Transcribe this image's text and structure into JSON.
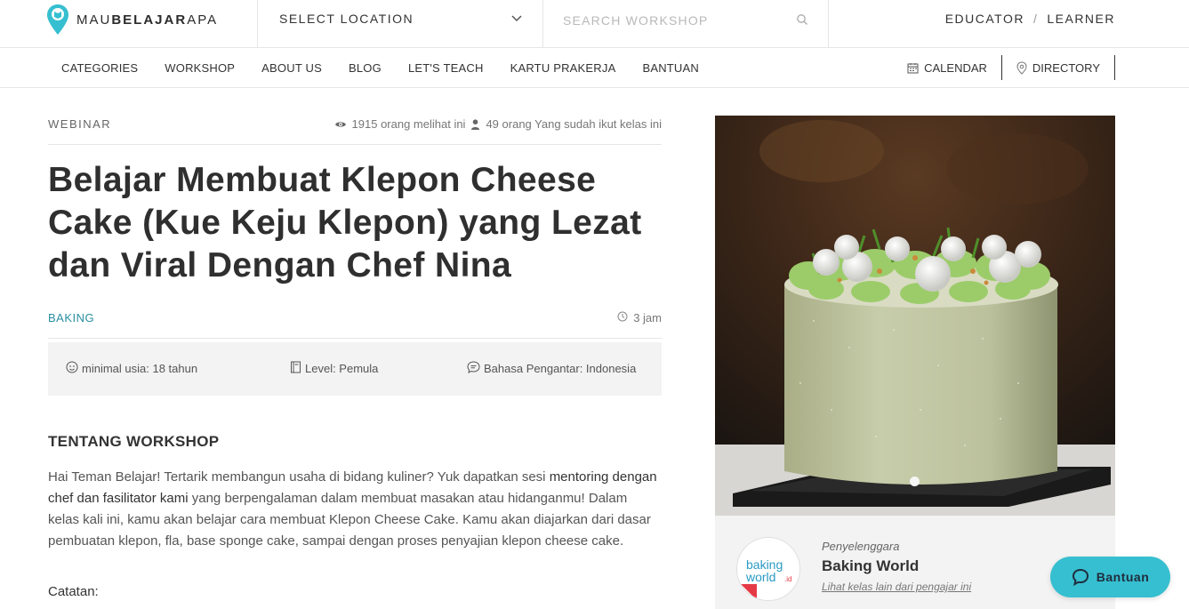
{
  "header": {
    "logo": {
      "part1": "MAU",
      "part2": "BELAJAR",
      "part3": "APA"
    },
    "location": {
      "label": "SELECT LOCATION"
    },
    "search": {
      "placeholder": "SEARCH WORKSHOP"
    },
    "user_links": {
      "educator": "EDUCATOR",
      "separator": "/",
      "learner": "LEARNER"
    }
  },
  "nav": {
    "items": [
      "CATEGORIES",
      "WORKSHOP",
      "ABOUT US",
      "BLOG",
      "LET'S TEACH",
      "KARTU PRAKERJA",
      "BANTUAN"
    ],
    "calendar": "CALENDAR",
    "directory": "DIRECTORY"
  },
  "workshop": {
    "type": "WEBINAR",
    "views": "1915 orang melihat ini",
    "joined": "49 orang Yang sudah ikut kelas ini",
    "title": "Belajar Membuat Klepon Cheese Cake (Kue Keju Klepon) yang Lezat dan Viral Dengan Chef Nina",
    "category": "BAKING",
    "duration": "3 jam",
    "info": {
      "min_age": "minimal usia: 18 tahun",
      "level": "Level: Pemula",
      "language": "Bahasa Pengantar: Indonesia"
    },
    "about_title": "TENTANG WORKSHOP",
    "description": {
      "part1": "Hai Teman Belajar! Tertarik membangun usaha di bidang kuliner? Yuk dapatkan sesi ",
      "highlight": "mentoring dengan chef dan fasilitator kami",
      "part2": " yang berpengalaman dalam membuat masakan atau hidanganmu! Dalam kelas kali ini, kamu akan belajar cara membuat Klepon Cheese Cake. Kamu akan diajarkan dari dasar pembuatan klepon, fla, base sponge cake, sampai dengan proses penyajian klepon cheese cake."
    },
    "note_label": "Catatan:"
  },
  "organizer": {
    "caption": "Penyelenggara",
    "name": "Baking World",
    "link": "Lihat kelas lain dari pengajar ini",
    "logo_text": {
      "line1": "baking",
      "line2": "world",
      "suffix": ".id"
    }
  },
  "help": {
    "label": "Bantuan"
  },
  "colors": {
    "accent": "#2a8fa3",
    "help_button": "#36bfd0",
    "info_bg": "#f3f3f3"
  }
}
